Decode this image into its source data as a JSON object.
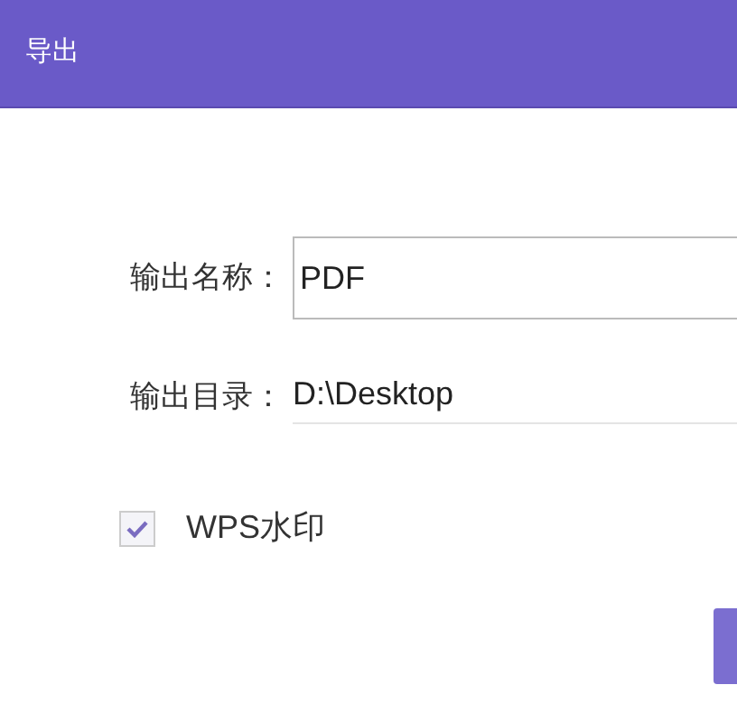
{
  "window": {
    "title": "导出"
  },
  "name_field": {
    "label": "输出名称：",
    "value": "PDF"
  },
  "directory": {
    "label": "输出目录：",
    "value": "D:\\Desktop"
  },
  "watermark_option": {
    "label": "WPS水印",
    "checked": true
  }
}
